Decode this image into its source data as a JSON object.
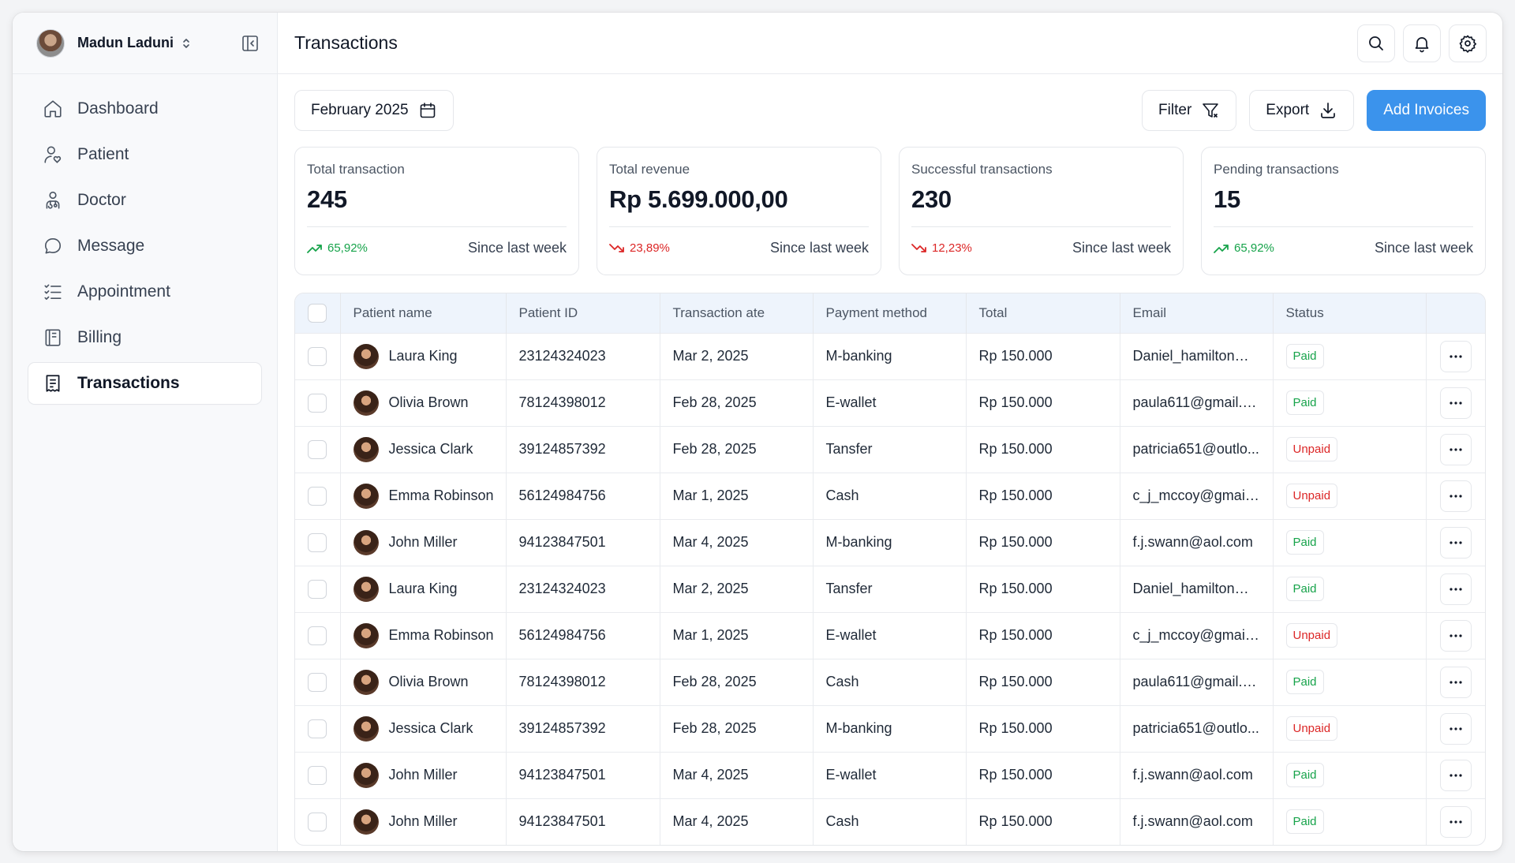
{
  "profile": {
    "name": "Madun Laduni"
  },
  "sidebar": {
    "items": [
      {
        "label": "Dashboard",
        "icon": "home-icon"
      },
      {
        "label": "Patient",
        "icon": "user-heart-icon"
      },
      {
        "label": "Doctor",
        "icon": "doctor-icon"
      },
      {
        "label": "Message",
        "icon": "chat-bubble-icon"
      },
      {
        "label": "Appointment",
        "icon": "checklist-icon"
      },
      {
        "label": "Billing",
        "icon": "book-icon"
      },
      {
        "label": "Transactions",
        "icon": "receipt-icon",
        "active": true
      }
    ]
  },
  "header": {
    "title": "Transactions"
  },
  "toolbar": {
    "date_label": "February 2025",
    "filter_label": "Filter",
    "export_label": "Export",
    "add_label": "Add Invoices"
  },
  "stats": [
    {
      "label": "Total transaction",
      "value": "245",
      "change": "65,92%",
      "trend": "up",
      "since": "Since last week"
    },
    {
      "label": "Total revenue",
      "value": "Rp 5.699.000,00",
      "change": "23,89%",
      "trend": "down",
      "since": "Since last week"
    },
    {
      "label": "Successful transactions",
      "value": "230",
      "change": "12,23%",
      "trend": "down",
      "since": "Since last week"
    },
    {
      "label": "Pending transactions",
      "value": "15",
      "change": "65,92%",
      "trend": "up",
      "since": "Since last week"
    }
  ],
  "table": {
    "columns": [
      "Patient name",
      "Patient ID",
      "Transaction ate",
      "Payment method",
      "Total",
      "Email",
      "Status"
    ],
    "rows": [
      {
        "name": "Laura King",
        "id": "23124324023",
        "date": "Mar 2, 2025",
        "method": "M-banking",
        "total": "Rp 150.000",
        "email": "Daniel_hamilton@...",
        "status": "Paid"
      },
      {
        "name": "Olivia Brown",
        "id": "78124398012",
        "date": "Feb 28, 2025",
        "method": "E-wallet",
        "total": "Rp 150.000",
        "email": "paula611@gmail.c...",
        "status": "Paid"
      },
      {
        "name": "Jessica Clark",
        "id": "39124857392",
        "date": "Feb 28, 2025",
        "method": "Tansfer",
        "total": "Rp 150.000",
        "email": "patricia651@outlo...",
        "status": "Unpaid"
      },
      {
        "name": "Emma Robinson",
        "id": "56124984756",
        "date": "Mar 1, 2025",
        "method": "Cash",
        "total": "Rp 150.000",
        "email": "c_j_mccoy@gmail...",
        "status": "Unpaid"
      },
      {
        "name": "John Miller",
        "id": "94123847501",
        "date": "Mar 4, 2025",
        "method": "M-banking",
        "total": "Rp 150.000",
        "email": "f.j.swann@aol.com",
        "status": "Paid"
      },
      {
        "name": "Laura King",
        "id": "23124324023",
        "date": "Mar 2, 2025",
        "method": "Tansfer",
        "total": "Rp 150.000",
        "email": "Daniel_hamilton@...",
        "status": "Paid"
      },
      {
        "name": "Emma Robinson",
        "id": "56124984756",
        "date": "Mar 1, 2025",
        "method": "E-wallet",
        "total": "Rp 150.000",
        "email": "c_j_mccoy@gmail...",
        "status": "Unpaid"
      },
      {
        "name": "Olivia Brown",
        "id": "78124398012",
        "date": "Feb 28, 2025",
        "method": "Cash",
        "total": "Rp 150.000",
        "email": "paula611@gmail.c...",
        "status": "Paid"
      },
      {
        "name": "Jessica Clark",
        "id": "39124857392",
        "date": "Feb 28, 2025",
        "method": "M-banking",
        "total": "Rp 150.000",
        "email": "patricia651@outlo...",
        "status": "Unpaid"
      },
      {
        "name": "John Miller",
        "id": "94123847501",
        "date": "Mar 4, 2025",
        "method": "E-wallet",
        "total": "Rp 150.000",
        "email": "f.j.swann@aol.com",
        "status": "Paid"
      },
      {
        "name": "John Miller",
        "id": "94123847501",
        "date": "Mar 4, 2025",
        "method": "Cash",
        "total": "Rp 150.000",
        "email": "f.j.swann@aol.com",
        "status": "Paid"
      }
    ]
  },
  "colors": {
    "accent": "#3b93ec",
    "paid": "#16a34a",
    "unpaid": "#dc2626",
    "header_bg": "#eef4fc"
  }
}
